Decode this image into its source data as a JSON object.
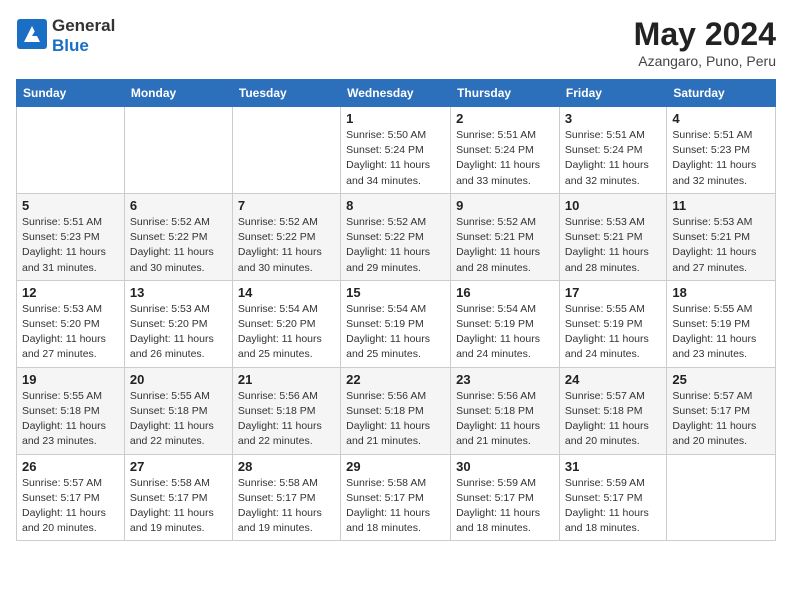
{
  "logo": {
    "general": "General",
    "blue": "Blue"
  },
  "header": {
    "month": "May 2024",
    "location": "Azangaro, Puno, Peru"
  },
  "weekdays": [
    "Sunday",
    "Monday",
    "Tuesday",
    "Wednesday",
    "Thursday",
    "Friday",
    "Saturday"
  ],
  "weeks": [
    [
      {
        "day": "",
        "info": ""
      },
      {
        "day": "",
        "info": ""
      },
      {
        "day": "",
        "info": ""
      },
      {
        "day": "1",
        "info": "Sunrise: 5:50 AM\nSunset: 5:24 PM\nDaylight: 11 hours\nand 34 minutes."
      },
      {
        "day": "2",
        "info": "Sunrise: 5:51 AM\nSunset: 5:24 PM\nDaylight: 11 hours\nand 33 minutes."
      },
      {
        "day": "3",
        "info": "Sunrise: 5:51 AM\nSunset: 5:24 PM\nDaylight: 11 hours\nand 32 minutes."
      },
      {
        "day": "4",
        "info": "Sunrise: 5:51 AM\nSunset: 5:23 PM\nDaylight: 11 hours\nand 32 minutes."
      }
    ],
    [
      {
        "day": "5",
        "info": "Sunrise: 5:51 AM\nSunset: 5:23 PM\nDaylight: 11 hours\nand 31 minutes."
      },
      {
        "day": "6",
        "info": "Sunrise: 5:52 AM\nSunset: 5:22 PM\nDaylight: 11 hours\nand 30 minutes."
      },
      {
        "day": "7",
        "info": "Sunrise: 5:52 AM\nSunset: 5:22 PM\nDaylight: 11 hours\nand 30 minutes."
      },
      {
        "day": "8",
        "info": "Sunrise: 5:52 AM\nSunset: 5:22 PM\nDaylight: 11 hours\nand 29 minutes."
      },
      {
        "day": "9",
        "info": "Sunrise: 5:52 AM\nSunset: 5:21 PM\nDaylight: 11 hours\nand 28 minutes."
      },
      {
        "day": "10",
        "info": "Sunrise: 5:53 AM\nSunset: 5:21 PM\nDaylight: 11 hours\nand 28 minutes."
      },
      {
        "day": "11",
        "info": "Sunrise: 5:53 AM\nSunset: 5:21 PM\nDaylight: 11 hours\nand 27 minutes."
      }
    ],
    [
      {
        "day": "12",
        "info": "Sunrise: 5:53 AM\nSunset: 5:20 PM\nDaylight: 11 hours\nand 27 minutes."
      },
      {
        "day": "13",
        "info": "Sunrise: 5:53 AM\nSunset: 5:20 PM\nDaylight: 11 hours\nand 26 minutes."
      },
      {
        "day": "14",
        "info": "Sunrise: 5:54 AM\nSunset: 5:20 PM\nDaylight: 11 hours\nand 25 minutes."
      },
      {
        "day": "15",
        "info": "Sunrise: 5:54 AM\nSunset: 5:19 PM\nDaylight: 11 hours\nand 25 minutes."
      },
      {
        "day": "16",
        "info": "Sunrise: 5:54 AM\nSunset: 5:19 PM\nDaylight: 11 hours\nand 24 minutes."
      },
      {
        "day": "17",
        "info": "Sunrise: 5:55 AM\nSunset: 5:19 PM\nDaylight: 11 hours\nand 24 minutes."
      },
      {
        "day": "18",
        "info": "Sunrise: 5:55 AM\nSunset: 5:19 PM\nDaylight: 11 hours\nand 23 minutes."
      }
    ],
    [
      {
        "day": "19",
        "info": "Sunrise: 5:55 AM\nSunset: 5:18 PM\nDaylight: 11 hours\nand 23 minutes."
      },
      {
        "day": "20",
        "info": "Sunrise: 5:55 AM\nSunset: 5:18 PM\nDaylight: 11 hours\nand 22 minutes."
      },
      {
        "day": "21",
        "info": "Sunrise: 5:56 AM\nSunset: 5:18 PM\nDaylight: 11 hours\nand 22 minutes."
      },
      {
        "day": "22",
        "info": "Sunrise: 5:56 AM\nSunset: 5:18 PM\nDaylight: 11 hours\nand 21 minutes."
      },
      {
        "day": "23",
        "info": "Sunrise: 5:56 AM\nSunset: 5:18 PM\nDaylight: 11 hours\nand 21 minutes."
      },
      {
        "day": "24",
        "info": "Sunrise: 5:57 AM\nSunset: 5:18 PM\nDaylight: 11 hours\nand 20 minutes."
      },
      {
        "day": "25",
        "info": "Sunrise: 5:57 AM\nSunset: 5:17 PM\nDaylight: 11 hours\nand 20 minutes."
      }
    ],
    [
      {
        "day": "26",
        "info": "Sunrise: 5:57 AM\nSunset: 5:17 PM\nDaylight: 11 hours\nand 20 minutes."
      },
      {
        "day": "27",
        "info": "Sunrise: 5:58 AM\nSunset: 5:17 PM\nDaylight: 11 hours\nand 19 minutes."
      },
      {
        "day": "28",
        "info": "Sunrise: 5:58 AM\nSunset: 5:17 PM\nDaylight: 11 hours\nand 19 minutes."
      },
      {
        "day": "29",
        "info": "Sunrise: 5:58 AM\nSunset: 5:17 PM\nDaylight: 11 hours\nand 18 minutes."
      },
      {
        "day": "30",
        "info": "Sunrise: 5:59 AM\nSunset: 5:17 PM\nDaylight: 11 hours\nand 18 minutes."
      },
      {
        "day": "31",
        "info": "Sunrise: 5:59 AM\nSunset: 5:17 PM\nDaylight: 11 hours\nand 18 minutes."
      },
      {
        "day": "",
        "info": ""
      }
    ]
  ]
}
